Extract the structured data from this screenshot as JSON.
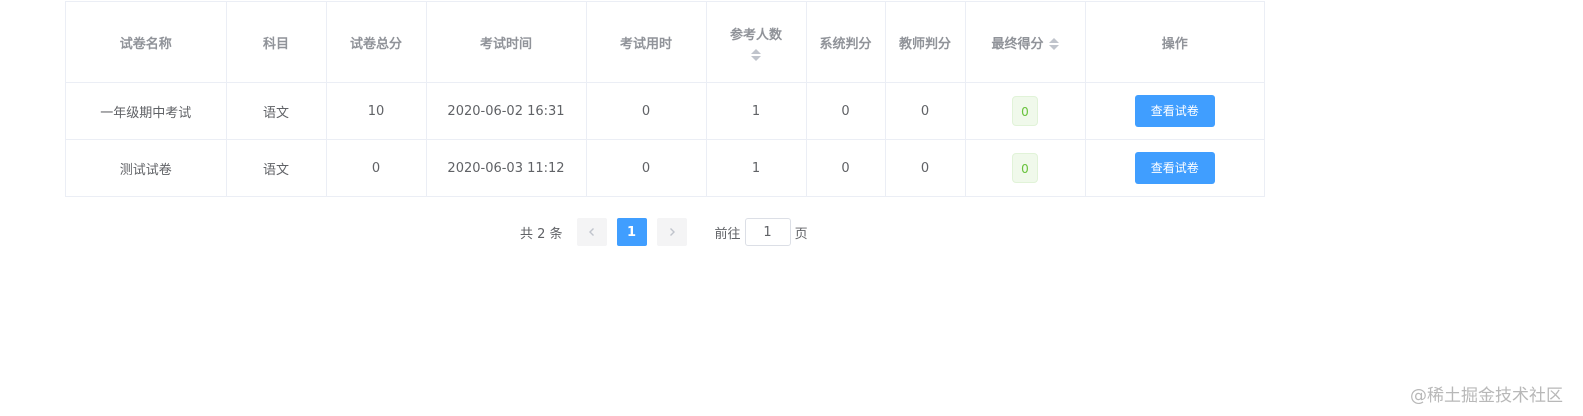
{
  "table": {
    "headers": {
      "name": "试卷名称",
      "subject": "科目",
      "total_score": "试卷总分",
      "exam_time": "考试时间",
      "duration": "考试用时",
      "participants": "参考人数",
      "system_score": "系统判分",
      "teacher_score": "教师判分",
      "final_score": "最终得分",
      "actions": "操作"
    },
    "rows": [
      {
        "name": "一年级期中考试",
        "subject": "语文",
        "total_score": "10",
        "exam_time": "2020-06-02 16:31",
        "duration": "0",
        "participants": "1",
        "system_score": "0",
        "teacher_score": "0",
        "final_score": "0",
        "action_label": "查看试卷"
      },
      {
        "name": "测试试卷",
        "subject": "语文",
        "total_score": "0",
        "exam_time": "2020-06-03 11:12",
        "duration": "0",
        "participants": "1",
        "system_score": "0",
        "teacher_score": "0",
        "final_score": "0",
        "action_label": "查看试卷"
      }
    ]
  },
  "pagination": {
    "total_text": "共 2 条",
    "current_page": "1",
    "goto_prefix": "前往",
    "goto_value": "1",
    "goto_suffix": "页",
    "prev_icon": "chevron-left-icon",
    "next_icon": "chevron-right-icon"
  },
  "watermark": "@稀土掘金技术社区",
  "colors": {
    "primary": "#409eff",
    "success_tag_bg": "#f0f9eb",
    "success_tag_text": "#67c23a",
    "border": "#ebeef5"
  }
}
